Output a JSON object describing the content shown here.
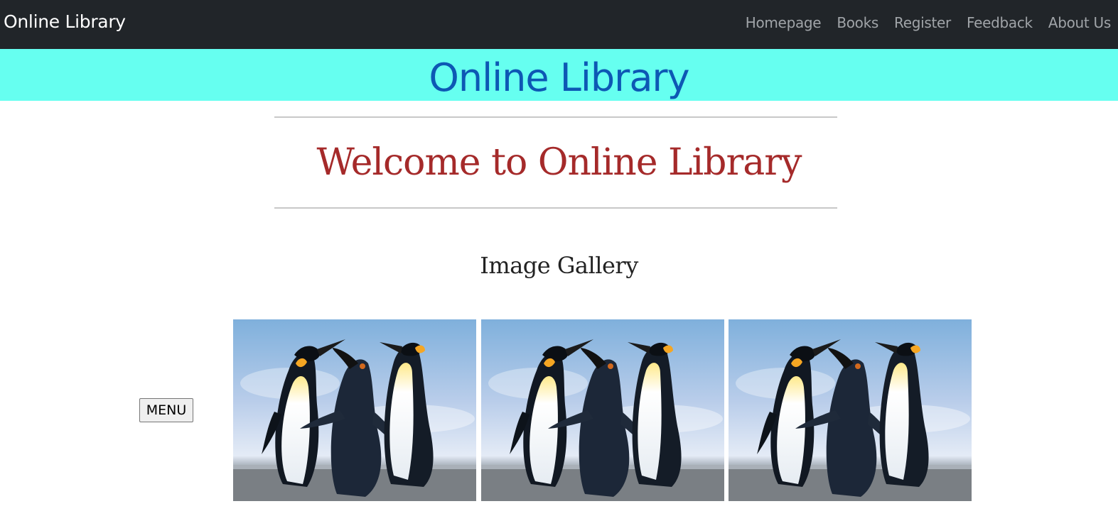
{
  "navbar": {
    "brand": "Online Library",
    "links": [
      "Homepage",
      "Books",
      "Register",
      "Feedback",
      "About Us"
    ]
  },
  "banner": {
    "title": "Online Library"
  },
  "main": {
    "welcome": "Welcome to Online Library",
    "gallery_heading": "Image Gallery",
    "menu_button": "MENU"
  },
  "gallery": {
    "images": [
      {
        "icon": "penguins-photo"
      },
      {
        "icon": "penguins-photo"
      },
      {
        "icon": "penguins-photo"
      }
    ]
  },
  "colors": {
    "navbar_bg": "#212529",
    "banner_bg": "#66fff0",
    "banner_text": "#0d58b4",
    "welcome_text": "#a52a2a"
  }
}
